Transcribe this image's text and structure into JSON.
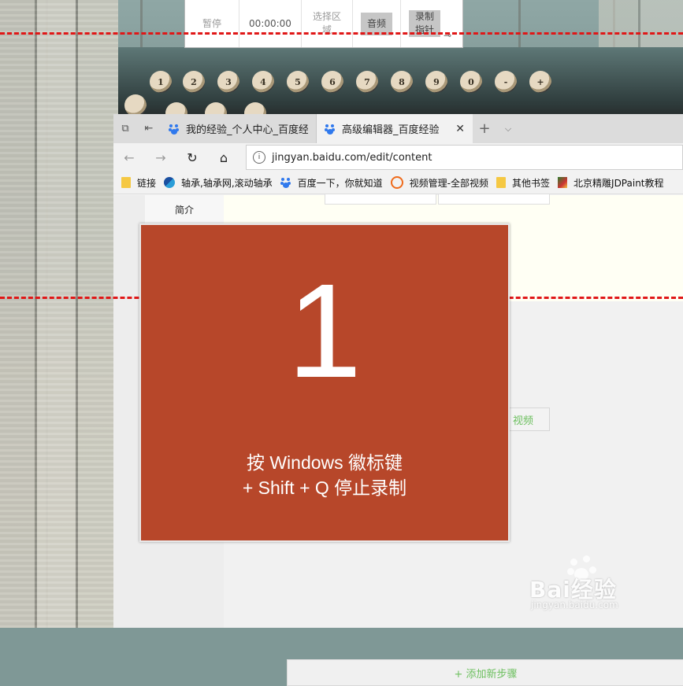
{
  "recorder": {
    "pause_label": "暂停",
    "timer": "00:00:00",
    "select_area_label": "选择区域",
    "audio_label": "音频",
    "record_pointer_label": "录制指针",
    "pin_icon": "pin-icon"
  },
  "browser": {
    "tabs": [
      {
        "title": "我的经验_个人中心_百度经验",
        "active": false
      },
      {
        "title": "高级编辑器_百度经验",
        "active": true
      }
    ],
    "tab_close": "✕",
    "new_tab": "+",
    "tab_menu": "⌵",
    "address": "jingyan.baidu.com/edit/content",
    "bookmarks": [
      {
        "label": "链接",
        "icon": "folder-icon"
      },
      {
        "label": "轴承,轴承网,滚动轴承",
        "icon": "bearing-logo-icon"
      },
      {
        "label": "百度一下，你就知道",
        "icon": "baidu-paw-icon"
      },
      {
        "label": "视频管理-全部视频",
        "icon": "video-logo-icon"
      },
      {
        "label": "其他书签",
        "icon": "folder-icon"
      },
      {
        "label": "北京精雕JDPaint教程",
        "icon": "jdpaint-logo-icon"
      }
    ]
  },
  "page": {
    "sidebar_intro": "简介",
    "video_button": "视频",
    "add_step": "+ 添加新步骤"
  },
  "countdown": {
    "number": "1",
    "message_line1": "按 Windows 徽标键",
    "message_line2": "+ Shift + Q 停止录制",
    "color": "#b7472a"
  },
  "watermark": {
    "brand": "Bai经验",
    "url": "jingyan.baidu.com"
  }
}
